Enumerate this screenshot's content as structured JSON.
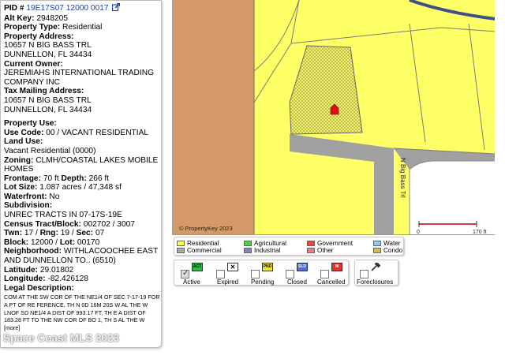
{
  "property": {
    "pid_label": "PID #",
    "pid_value": "19E17S07 12000 0017",
    "alt_key_label": "Alt Key:",
    "alt_key_value": "2948205",
    "type_label": "Property Type:",
    "type_value": "Residential",
    "address_label": "Property Address:",
    "address_line1": "10657 N BIG BASS TRL",
    "address_line2": "DUNNELLON, FL 34434",
    "owner_label": "Current Owner:",
    "owner_value": "JEREMIAHS INTERNATIONAL TRADING COMPANY INC",
    "mailing_label": "Tax Mailing Address:",
    "mailing_line1": "10657 N BIG BASS TRL",
    "mailing_line2": "DUNNELLON, FL 34434",
    "use_header": "Property Use:",
    "use_code_label": "Use Code:",
    "use_code_value": "00 / VACANT RESIDENTIAL",
    "land_use_label": "Land Use:",
    "land_use_value": "Vacant Residential (0000)",
    "zoning_label": "Zoning:",
    "zoning_value": "CLMH/COASTAL LAKES MOBILE HOMES",
    "frontage_label": "Frontage:",
    "frontage_value": "70 ft",
    "depth_label": "Depth:",
    "depth_value": "266 ft",
    "lot_size_label": "Lot Size:",
    "lot_size_value": "1.087 acres / 47,348 sf",
    "waterfront_label": "Waterfront:",
    "waterfront_value": "No",
    "subdivision_label": "Subdivision:",
    "subdivision_value": "UNREC TRACTS IN 07-17S-19E",
    "census_label": "Census Tract/Block:",
    "census_value": "002702 / 3007",
    "twn_label": "Twn:",
    "twn_value": "17",
    "rng_label": "Rng:",
    "rng_value": "19",
    "sec_label": "Sec:",
    "sec_value": "07",
    "block_label": "Block:",
    "block_value": "12000",
    "lot_label": "Lot:",
    "lot_value": "00170",
    "neighborhood_label": "Neighborhood:",
    "neighborhood_value": "WITHLACOOCHEE EAST AND DUNNELLON TO.. (6510)",
    "latitude_label": "Latitude:",
    "latitude_value": "29.01802",
    "longitude_label": "Longitude:",
    "longitude_value": "-82.426128",
    "legal_label": "Legal Description:",
    "legal_value": "COM AT THE SW COR OF THE NE1/4 OF SEC 7-17-19 FOR A PT OF RE FERENCE, TH N 0D 16M 20S W AL THE W LNOF SD NE1/4 A DIST OF 993.17 FT, TH E A DIST OF 183.28 FT TO THE NW COR OF BO 1, TH S AL THE W [more]"
  },
  "watermark": "Space Coast MLS 2023",
  "map": {
    "road_label": "N Big Bass Trl",
    "copyright": "© PropertyKey 2023",
    "scale_start": "0",
    "scale_end": "170 ft",
    "colors": {
      "residential": "#ffff66",
      "commercial": "#a9a9a9",
      "road": "#a0a0a0",
      "brown_area": "#d39a68",
      "water": "#3f4f8c"
    }
  },
  "legend": {
    "residential": "Residential",
    "commercial": "Commercial",
    "agricultural": "Agricultural",
    "industrial": "Industrial",
    "government": "Government",
    "other": "Other",
    "water": "Water",
    "condo": "Condo"
  },
  "filters": {
    "active": "Active",
    "expired": "Expired",
    "pending": "Pending",
    "closed": "Closed",
    "cancelled": "Cancelled",
    "foreclosures": "Foreclosures",
    "badge_active": "ACT",
    "badge_pending": "PND",
    "badge_closed": "SLD",
    "badge_cancelled": "W"
  }
}
